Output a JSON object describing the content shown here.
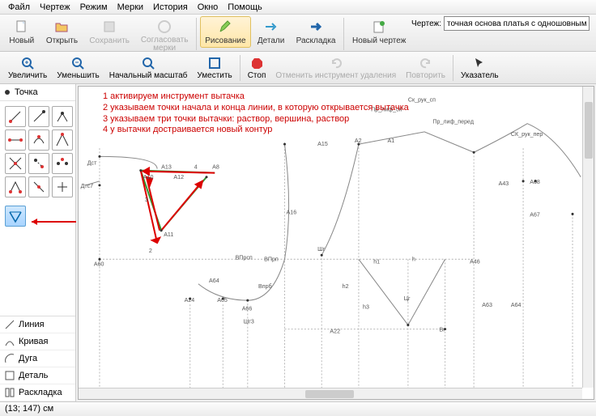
{
  "menu": [
    "Файл",
    "Чертеж",
    "Режим",
    "Мерки",
    "История",
    "Окно",
    "Помощь"
  ],
  "tb1": {
    "new": "Новый",
    "open": "Открыть",
    "save": "Сохранить",
    "sync": "Согласовать\nмерки",
    "draw": "Рисование",
    "details": "Детали",
    "layout": "Раскладка",
    "newdraw": "Новый чертеж",
    "field_label": "Чертеж:",
    "field_value": "точная основа платья с одношовным рука"
  },
  "tb2": {
    "zoomin": "Увеличить",
    "zoomout": "Уменьшить",
    "zoomfit": "Начальный масштаб",
    "fit": "Уместить",
    "stop": "Стоп",
    "undo": "Отменить инструмент удаления",
    "redo": "Повторить",
    "pointer": "Указатель"
  },
  "side": {
    "head": "Точка",
    "modes": [
      "Линия",
      "Кривая",
      "Дуга",
      "Деталь",
      "Раскладка"
    ]
  },
  "side_marker": "1",
  "instructions": [
    "1 активируем инструмент вытачка",
    "2 указываем точки начала и конца линии, в которую открывается вытачка",
    "3 указываем три точки вытачки: раствор, вершина, раствор",
    "4 у вытачки достраивается новый контур"
  ],
  "dart_labels": {
    "n2": "2",
    "n3": "3",
    "n4": "4"
  },
  "points": {
    "Дст": "Дст",
    "Дтс7": "Дтс7",
    "А60": "А60",
    "А24": "А24",
    "А65": "А65",
    "А64": "А64",
    "А66": "А66",
    "Шг3": "Шг3",
    "Впрб": "Впрб",
    "ВПрсп": "ВПрсп",
    "ВПрп": "ВПрп",
    "А16": "А16",
    "Шг": "Шг",
    "А22": "А22",
    "Цг": "Цг",
    "Вг": "Вг",
    "h1": "h1",
    "h2": "h2",
    "h3": "h3",
    "h": "h",
    "А15": "А15",
    "А2": "А2",
    "А1": "А1",
    "Пр_лиф_сп": "Пр_лиф_сп",
    "Пр_лиф_перед": "Пр_лиф_перед",
    "Ск_рук_сп": "Ск_рук_сп",
    "СК_рук_пер": "СК_рук_пер",
    "А43": "А43",
    "А68": "А68",
    "А67": "А67",
    "А63": "А63",
    "А64b": "А64",
    "А46": "А46",
    "А13": "А13",
    "А12": "А12",
    "А10": "А10",
    "А11": "А11",
    "А8": "А8"
  },
  "status": "(13; 147) см"
}
